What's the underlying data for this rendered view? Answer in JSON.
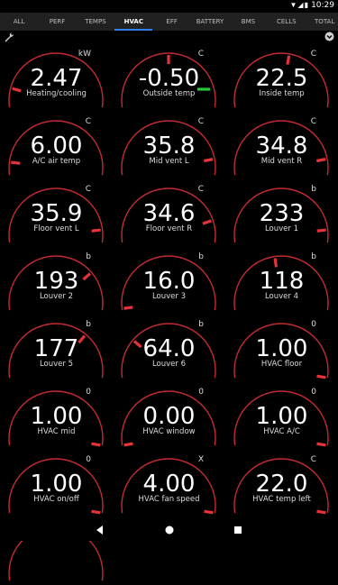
{
  "status_bar": {
    "time": "10:29",
    "icons": [
      "wifi-icon",
      "signal-icon",
      "battery-icon"
    ]
  },
  "tabs": [
    {
      "label": "ALL",
      "active": false
    },
    {
      "label": "PERF",
      "active": false
    },
    {
      "label": "TEMPS",
      "active": false
    },
    {
      "label": "HVAC",
      "active": true
    },
    {
      "label": "EFF",
      "active": false
    },
    {
      "label": "BATTERY",
      "active": false
    },
    {
      "label": "BMS",
      "active": false
    },
    {
      "label": "CELLS",
      "active": false
    },
    {
      "label": "TOTAL",
      "active": false
    }
  ],
  "colors": {
    "accent": "#2f80ed",
    "gauge": "#e5323b",
    "positive": "#27c93f",
    "background": "#000000",
    "tabbar": "#212121"
  },
  "toolbar": {
    "left_icon": "wrench-icon",
    "right_icon": "dropdown-circle-icon"
  },
  "gauges": [
    {
      "value": "2.47",
      "label": "Heating/cooling",
      "unit": "kW",
      "level": 0.12
    },
    {
      "value": "-0.50",
      "label": "Outside temp",
      "unit": "C",
      "level": 0.5,
      "indicator": "green"
    },
    {
      "value": "22.5",
      "label": "Inside temp",
      "unit": "C",
      "level": 0.55
    },
    {
      "value": "6.00",
      "label": "A/C air temp",
      "unit": "C",
      "level": 0.08
    },
    {
      "value": "35.8",
      "label": "Mid vent L",
      "unit": "C",
      "level": 0.9
    },
    {
      "value": "34.8",
      "label": "Mid vent R",
      "unit": "C",
      "level": 0.9
    },
    {
      "value": "35.9",
      "label": "Floor vent L",
      "unit": "C",
      "level": 0.92
    },
    {
      "value": "34.6",
      "label": "Floor vent R",
      "unit": "C",
      "level": 0.86
    },
    {
      "value": "233",
      "label": "Louver 1",
      "unit": "b",
      "level": 0.92
    },
    {
      "value": "193",
      "label": "Louver 2",
      "unit": "b",
      "level": 0.75
    },
    {
      "value": "16.0",
      "label": "Louver 3",
      "unit": "b",
      "level": 0.01
    },
    {
      "value": "118",
      "label": "Louver 4",
      "unit": "b",
      "level": 0.46
    },
    {
      "value": "177",
      "label": "Louver 5",
      "unit": "b",
      "level": 0.7
    },
    {
      "value": "64.0",
      "label": "Louver 6",
      "unit": "b",
      "level": 0.25
    },
    {
      "value": "1.00",
      "label": "HVAC floor",
      "unit": "0",
      "level": 1.0
    },
    {
      "value": "1.00",
      "label": "HVAC mid",
      "unit": "0",
      "level": 1.0
    },
    {
      "value": "0.00",
      "label": "HVAC window",
      "unit": "0",
      "level": 0.0
    },
    {
      "value": "1.00",
      "label": "HVAC A/C",
      "unit": "0",
      "level": 1.0
    },
    {
      "value": "1.00",
      "label": "HVAC on/off",
      "unit": "0",
      "level": 1.0
    },
    {
      "value": "4.00",
      "label": "HVAC fan speed",
      "unit": "X",
      "level": 1.0
    },
    {
      "value": "22.0",
      "label": "HVAC temp left",
      "unit": "C",
      "level": 1.0
    },
    {
      "value": "",
      "label": "",
      "unit": "",
      "level": 0.58
    }
  ],
  "nav": {
    "back": "back-icon",
    "home": "home-icon",
    "recents": "recents-icon"
  }
}
